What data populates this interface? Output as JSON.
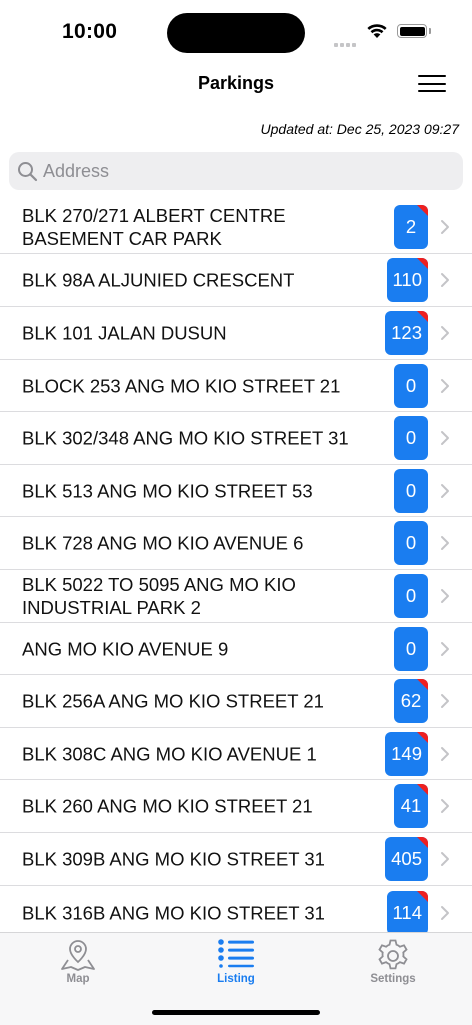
{
  "status_bar": {
    "time": "10:00"
  },
  "header": {
    "title": "Parkings",
    "menu_icon": "hamburger-menu-icon"
  },
  "updated_at": "Updated at: Dec 25, 2023 09:27",
  "search": {
    "placeholder": "Address",
    "value": ""
  },
  "colors": {
    "accent": "#1a7df0",
    "flag": "#ee2020",
    "inactive": "#8e8e93"
  },
  "parkings": [
    {
      "name": "BLK 270/271 ALBERT CENTRE BASEMENT CAR PARK",
      "lots": "2",
      "flag": true
    },
    {
      "name": "BLK 98A ALJUNIED CRESCENT",
      "lots": "110",
      "flag": true
    },
    {
      "name": "BLK 101 JALAN DUSUN",
      "lots": "123",
      "flag": true
    },
    {
      "name": "BLOCK 253 ANG MO KIO STREET 21",
      "lots": "0",
      "flag": false
    },
    {
      "name": "BLK 302/348 ANG MO KIO STREET 31",
      "lots": "0",
      "flag": false
    },
    {
      "name": "BLK 513 ANG MO KIO STREET 53",
      "lots": "0",
      "flag": false
    },
    {
      "name": "BLK 728 ANG MO KIO AVENUE 6",
      "lots": "0",
      "flag": false
    },
    {
      "name": "BLK 5022 TO 5095 ANG MO KIO INDUSTRIAL PARK 2",
      "lots": "0",
      "flag": false
    },
    {
      "name": "ANG MO KIO AVENUE 9",
      "lots": "0",
      "flag": false
    },
    {
      "name": "BLK 256A ANG MO KIO STREET 21",
      "lots": "62",
      "flag": true
    },
    {
      "name": "BLK 308C ANG MO KIO AVENUE 1",
      "lots": "149",
      "flag": true
    },
    {
      "name": "BLK 260 ANG MO KIO STREET 21",
      "lots": "41",
      "flag": true
    },
    {
      "name": "BLK 309B ANG MO KIO STREET 31",
      "lots": "405",
      "flag": true
    },
    {
      "name": "BLK 316B ANG MO KIO STREET 31",
      "lots": "114",
      "flag": true
    }
  ],
  "tabs": [
    {
      "label": "Map",
      "icon": "map-icon",
      "active": false
    },
    {
      "label": "Listing",
      "icon": "list-icon",
      "active": true
    },
    {
      "label": "Settings",
      "icon": "gear-icon",
      "active": false
    }
  ]
}
